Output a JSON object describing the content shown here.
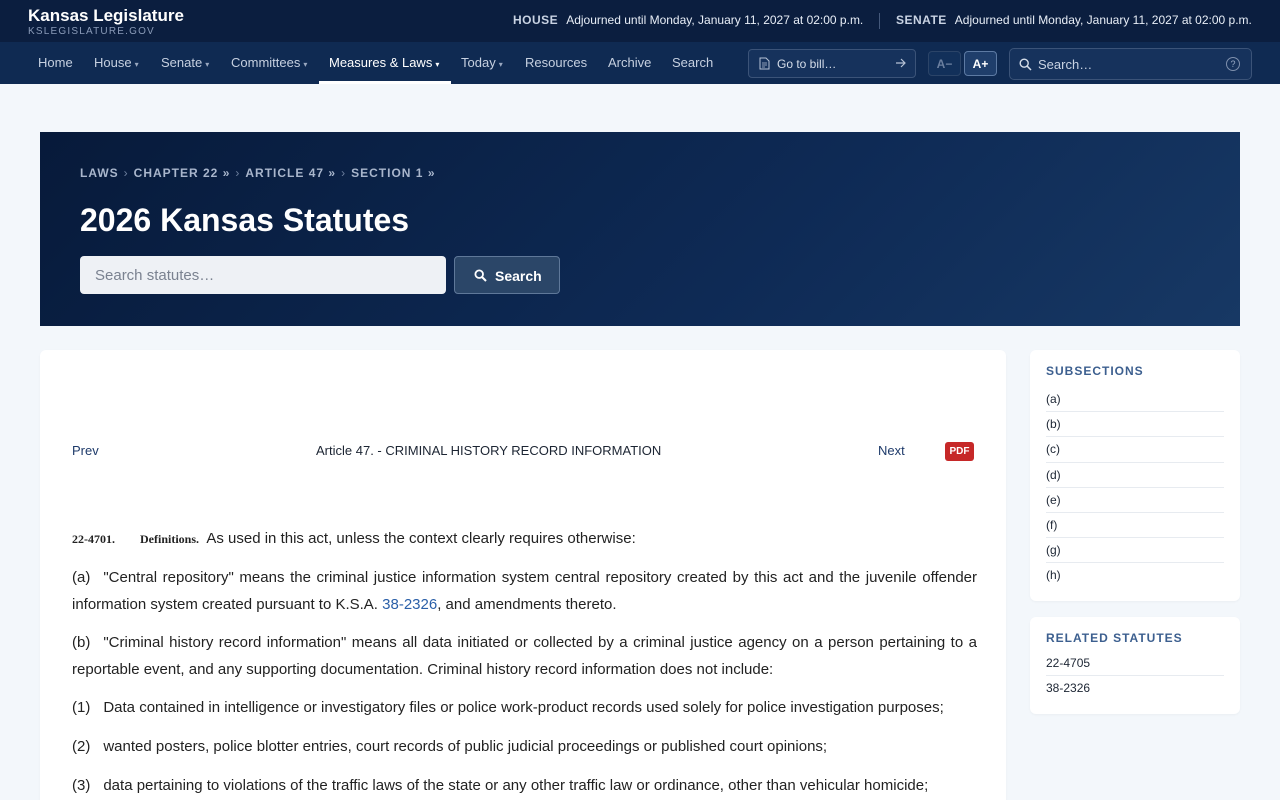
{
  "header": {
    "title": "Kansas Legislature",
    "url": "KSLEGISLATURE.GOV",
    "house": {
      "label": "HOUSE",
      "status": "Adjourned until Monday, January 11, 2027 at 02:00 p.m."
    },
    "senate": {
      "label": "SENATE",
      "status": "Adjourned until Monday, January 11, 2027 at 02:00 p.m."
    }
  },
  "nav": {
    "items": [
      {
        "label": "Home",
        "caret": ""
      },
      {
        "label": "House",
        "caret": "▾"
      },
      {
        "label": "Senate",
        "caret": "▾"
      },
      {
        "label": "Committees",
        "caret": "▾"
      },
      {
        "label": "Measures & Laws",
        "caret": "▾"
      },
      {
        "label": "Today",
        "caret": "▾"
      },
      {
        "label": "Resources",
        "caret": ""
      },
      {
        "label": "Archive",
        "caret": ""
      },
      {
        "label": "Search",
        "caret": ""
      }
    ],
    "active": "Measures & Laws",
    "goto_bill": "Go to bill…",
    "font_decrease": "A−",
    "font_increase": "A+",
    "search_placeholder": "Search…",
    "help": "?"
  },
  "hero": {
    "breadcrumb": [
      "LAWS",
      "CHAPTER 22",
      "ARTICLE 47",
      "SECTION 1"
    ],
    "breadcrumb_sep": "›",
    "breadcrumb_suffix": "»",
    "title": "2026 Kansas Statutes",
    "search_placeholder": "Search statutes…",
    "search_button": "Search"
  },
  "article": {
    "prev": "Prev",
    "title": "Article 47. - CRIMINAL HISTORY RECORD INFORMATION",
    "next": "Next",
    "pdf": "PDF",
    "section_number": "22-4701.",
    "section_name": "Definitions.",
    "intro": "As used in this act, unless the context clearly requires otherwise:",
    "paragraphs": [
      {
        "label": "(a)",
        "text_before": "\"Central repository\" means the criminal justice information system central repository created by this act and the juvenile offender information system created pursuant to K.S.A.",
        "link": "38-2326",
        "text_after": ", and amendments thereto."
      },
      {
        "label": "(b)",
        "text": "\"Criminal history record information\" means all data initiated or collected by a criminal justice agency on a person pertaining to a reportable event, and any supporting documentation. Criminal history record information does not include:"
      },
      {
        "label": "(1)",
        "text": "Data contained in intelligence or investigatory files or police work-product records used solely for police investigation purposes;"
      },
      {
        "label": "(2)",
        "text": "wanted posters, police blotter entries, court records of public judicial proceedings or published court opinions;"
      },
      {
        "label": "(3)",
        "text": "data pertaining to violations of the traffic laws of the state or any other traffic law or ordinance, other than vehicular homicide;"
      }
    ]
  },
  "sidebar": {
    "subsections_heading": "SUBSECTIONS",
    "subsections": [
      "(a)",
      "(b)",
      "(c)",
      "(d)",
      "(e)",
      "(f)",
      "(g)",
      "(h)"
    ],
    "related_heading": "RELATED STATUTES",
    "related": [
      "22-4705",
      "38-2326"
    ]
  },
  "colors": {
    "topbar": "#0b1e3f",
    "navbar": "#0f2a52",
    "hero": "#0e2a55",
    "pdf_badge": "#c62828",
    "link": "#2a5fa8",
    "sidebar_heading": "#3c5f8f"
  }
}
